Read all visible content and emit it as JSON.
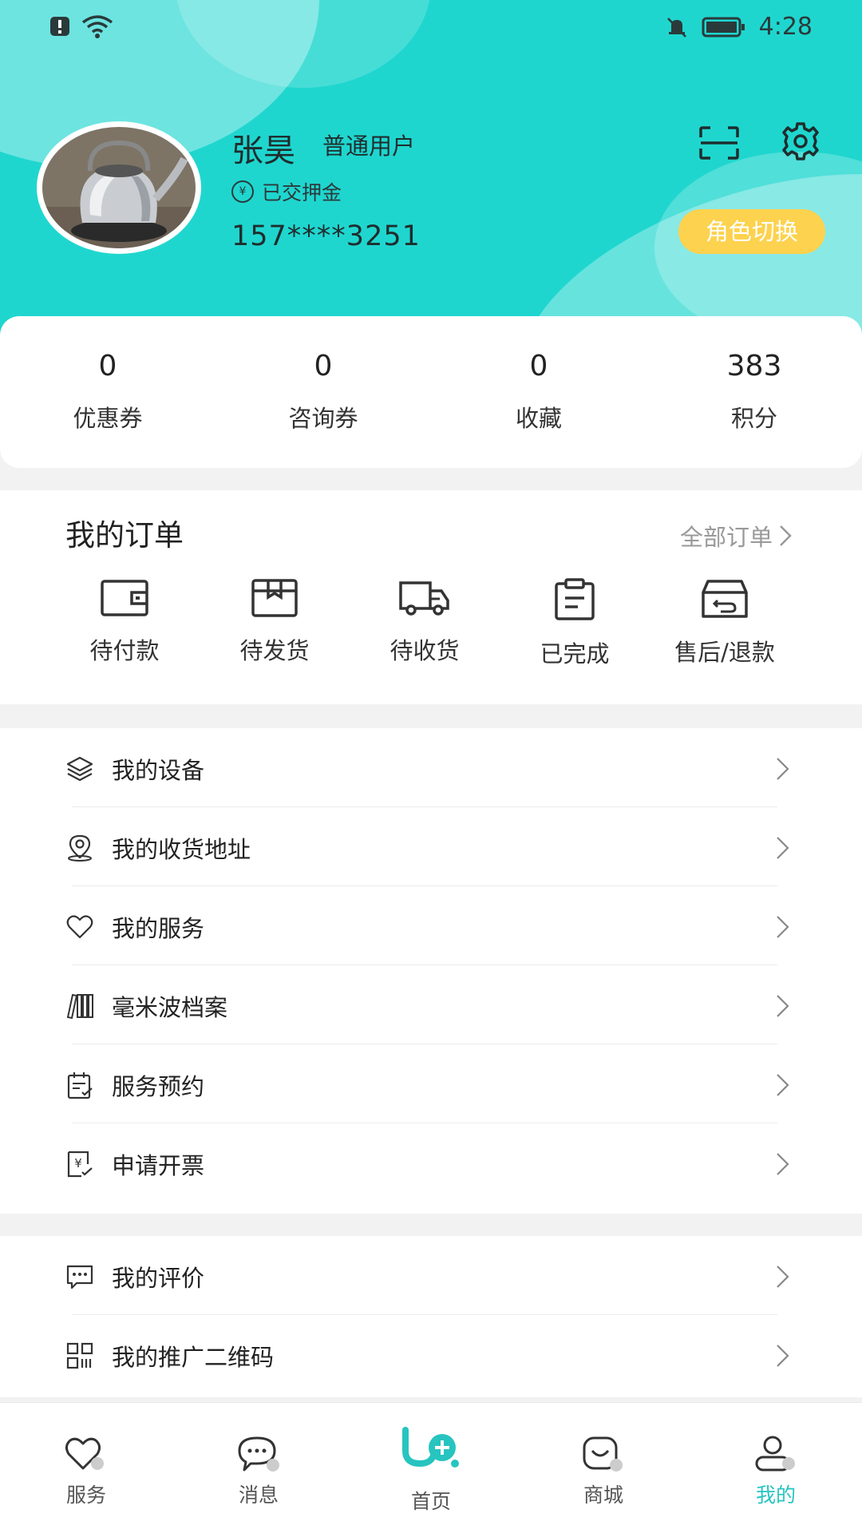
{
  "status_bar": {
    "time": "4:28"
  },
  "profile": {
    "name": "张昊",
    "user_type": "普通用户",
    "deposit_status": "已交押金",
    "phone": "157****3251",
    "role_switch_label": "角色切换"
  },
  "stats": [
    {
      "value": "0",
      "label": "优惠券"
    },
    {
      "value": "0",
      "label": "咨询券"
    },
    {
      "value": "0",
      "label": "收藏"
    },
    {
      "value": "383",
      "label": "积分"
    }
  ],
  "orders": {
    "title": "我的订单",
    "all_label": "全部订单",
    "items": [
      {
        "label": "待付款",
        "icon": "wallet-icon"
      },
      {
        "label": "待发货",
        "icon": "package-icon"
      },
      {
        "label": "待收货",
        "icon": "truck-icon"
      },
      {
        "label": "已完成",
        "icon": "clipboard-icon"
      },
      {
        "label": "售后/退款",
        "icon": "return-box-icon"
      }
    ]
  },
  "menu_group_1": [
    {
      "label": "我的设备",
      "icon": "layers-icon"
    },
    {
      "label": "我的收货地址",
      "icon": "location-icon"
    },
    {
      "label": "我的服务",
      "icon": "heart-icon"
    },
    {
      "label": "毫米波档案",
      "icon": "books-icon"
    },
    {
      "label": "服务预约",
      "icon": "calendar-icon"
    },
    {
      "label": "申请开票",
      "icon": "invoice-icon"
    }
  ],
  "menu_group_2": [
    {
      "label": "我的评价",
      "icon": "comment-icon"
    },
    {
      "label": "我的推广二维码",
      "icon": "qrcode-icon"
    }
  ],
  "tab_bar": [
    {
      "label": "服务",
      "icon": "heart-tab-icon"
    },
    {
      "label": "消息",
      "icon": "message-tab-icon"
    },
    {
      "label": "首页",
      "icon": "home-tab-icon"
    },
    {
      "label": "商城",
      "icon": "shop-tab-icon"
    },
    {
      "label": "我的",
      "icon": "profile-tab-icon",
      "active": true
    }
  ],
  "colors": {
    "accent": "#1fd6cf",
    "role_button": "#fdd24e",
    "active_tab": "#27c4c0"
  }
}
